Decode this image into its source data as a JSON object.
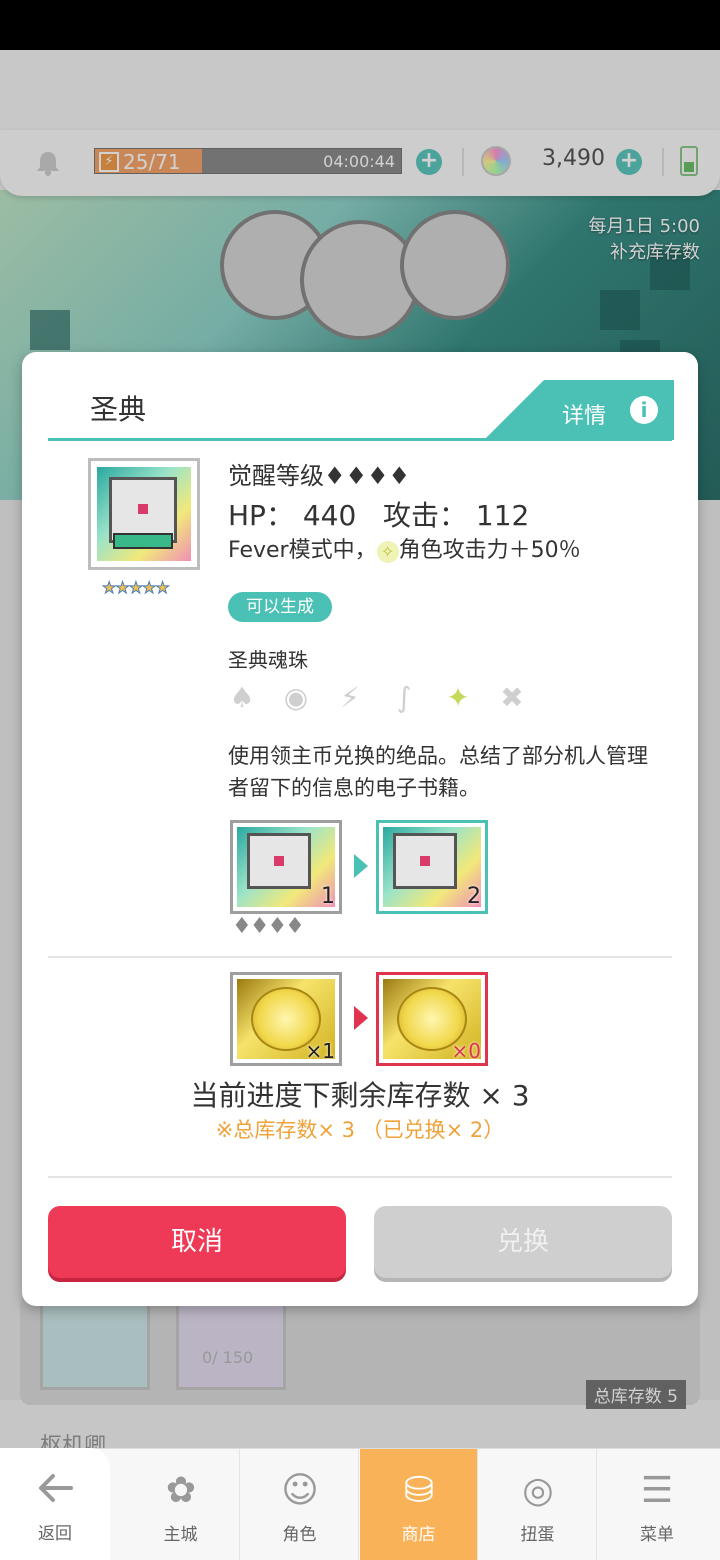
{
  "hud": {
    "stamina": "25/71",
    "stamina_fill": 0.35,
    "timer": "04:00:44",
    "gem_count": "3,490"
  },
  "banner": {
    "restock_line1": "每月1日 5:00",
    "restock_line2": "补充库存数"
  },
  "modal": {
    "title": "圣典",
    "details_label": "详情",
    "info_icon": "i",
    "rarity_stars": "★★★★★",
    "awaken_label": "觉醒等级♦♦♦♦",
    "stats": "HP： 440   攻击： 112",
    "fever_prefix": "Fever模式中，",
    "fever_suffix": "角色攻击力＋50％",
    "badge": "可以生成",
    "soul_label": "圣典魂珠",
    "attributes": [
      "♠",
      "◉",
      "⚡",
      "∫",
      "✦",
      "✖"
    ],
    "description": "使用领主币兑换的绝品。总结了部分机人管理者留下的信息的电子书籍。",
    "upgrade_from_count": "1",
    "upgrade_to_count": "2",
    "upgrade_diamonds": "♦♦♦♦",
    "coin_have": "×1",
    "coin_after": "×0",
    "remaining": "当前进度下剩余库存数 × 3",
    "total_note": "※总库存数× 3 （已兑换× 2）",
    "cancel_label": "取消",
    "exchange_label": "兑换"
  },
  "background": {
    "item_count": "0/ 150",
    "total_stock": "总库存数 5",
    "section_label": "枢机卿"
  },
  "nav": {
    "back": "返回",
    "items": [
      "主城",
      "角色",
      "商店",
      "扭蛋",
      "菜单"
    ]
  }
}
